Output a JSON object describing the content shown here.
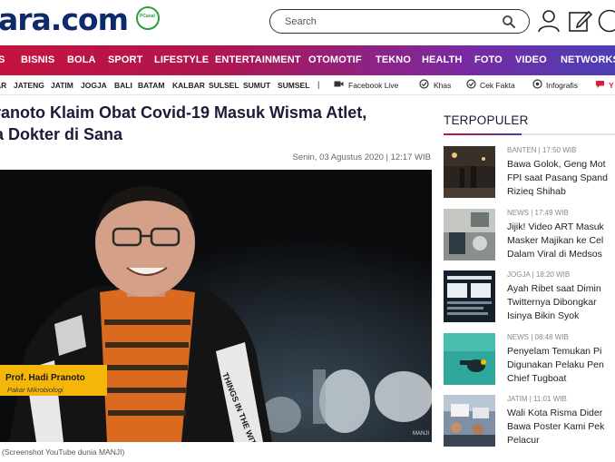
{
  "header": {
    "logo_text": "ara.com",
    "logo_badge": "PCanal",
    "search_placeholder": "Search"
  },
  "main_nav": [
    "S",
    "BISNIS",
    "BOLA",
    "SPORT",
    "LIFESTYLE",
    "ENTERTAINMENT",
    "OTOMOTIF",
    "TEKNO",
    "HEALTH",
    "FOTO",
    "VIDEO",
    "NETWORKS"
  ],
  "sub_nav": {
    "regions": [
      "AR",
      "JATENG",
      "JATIM",
      "JOGJA",
      "BALI",
      "BATAM",
      "KALBAR",
      "SULSEL",
      "SUMUT",
      "SUMSEL"
    ],
    "separator": "|",
    "links": [
      "Facebook Live",
      "Khas",
      "Cek Fakta",
      "Infografis",
      "Y"
    ]
  },
  "article": {
    "headline_line1": "ranoto Klaim Obat Covid-19 Masuk Wisma Atlet,",
    "headline_line2": "a Dokter di Sana",
    "date": "Senin, 03 Agustus 2020 | 12:17 WIB",
    "caption_name": "Prof. Hadi Pranoto",
    "caption_role": "Pakar Mikrobiologi",
    "photo_credit": "(Screenshot YouTube dunia MANJI)",
    "photo_watermark": "MANJI",
    "shirt_text": "THINGS IN THE WITH"
  },
  "sidebar": {
    "title": "TERPOPULER",
    "items": [
      {
        "meta": "BANTEN | 17:50 WIB",
        "lines": [
          "Bawa Golok, Geng Mot",
          "FPI saat Pasang Spand",
          "Rizieq Shihab"
        ]
      },
      {
        "meta": "NEWS | 17:49 WIB",
        "lines": [
          "Jijik! Video ART Masuk",
          "Masker Majikan ke Cel",
          "Dalam Viral di Medsos"
        ]
      },
      {
        "meta": "JOGJA | 18:20 WIB",
        "lines": [
          "Ayah Ribet saat Dimin",
          "Twitternya Dibongkar",
          "Isinya Bikin Syok"
        ]
      },
      {
        "meta": "NEWS | 08:48 WIB",
        "lines": [
          "Penyelam Temukan Pi",
          "Digunakan Pelaku Pen",
          "Chief Tugboat"
        ]
      },
      {
        "meta": "JATIM | 11:01 WIB",
        "lines": [
          "Wali Kota Risma Dider",
          "Bawa Poster Kami Pek",
          "Pelacur"
        ]
      }
    ]
  },
  "colors": {
    "nav_start": "#c3133d",
    "nav_end": "#4b3fb6",
    "caption_bg": "#f5b60a",
    "headline": "#1b1b3a"
  }
}
